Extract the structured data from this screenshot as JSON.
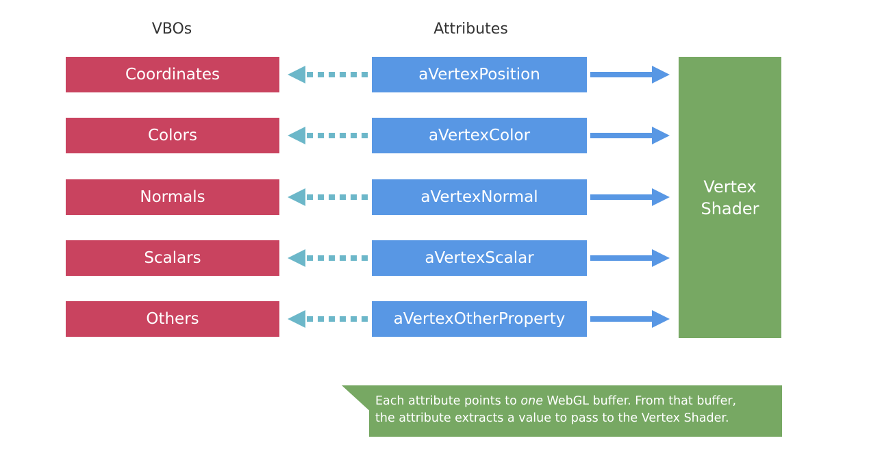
{
  "headers": {
    "vbos": "VBOs",
    "attributes": "Attributes"
  },
  "rows": [
    {
      "vbo": "Coordinates",
      "attribute": "aVertexPosition"
    },
    {
      "vbo": "Colors",
      "attribute": "aVertexColor"
    },
    {
      "vbo": "Normals",
      "attribute": "aVertexNormal"
    },
    {
      "vbo": "Scalars",
      "attribute": "aVertexScalar"
    },
    {
      "vbo": "Others",
      "attribute": "aVertexOtherProperty"
    }
  ],
  "shader": {
    "line1": "Vertex",
    "line2": "Shader"
  },
  "callout": {
    "part1": "Each attribute points to ",
    "emphasis": "one",
    "part2": " WebGL buffer. From that buffer,",
    "line2": "the attribute extracts a value to pass to the Vertex Shader."
  },
  "colors": {
    "vbo": "#c9435f",
    "attribute": "#5897e4",
    "shader": "#77a863",
    "dashed_arrow": "#6cb7c9",
    "solid_arrow": "#5897e4"
  }
}
